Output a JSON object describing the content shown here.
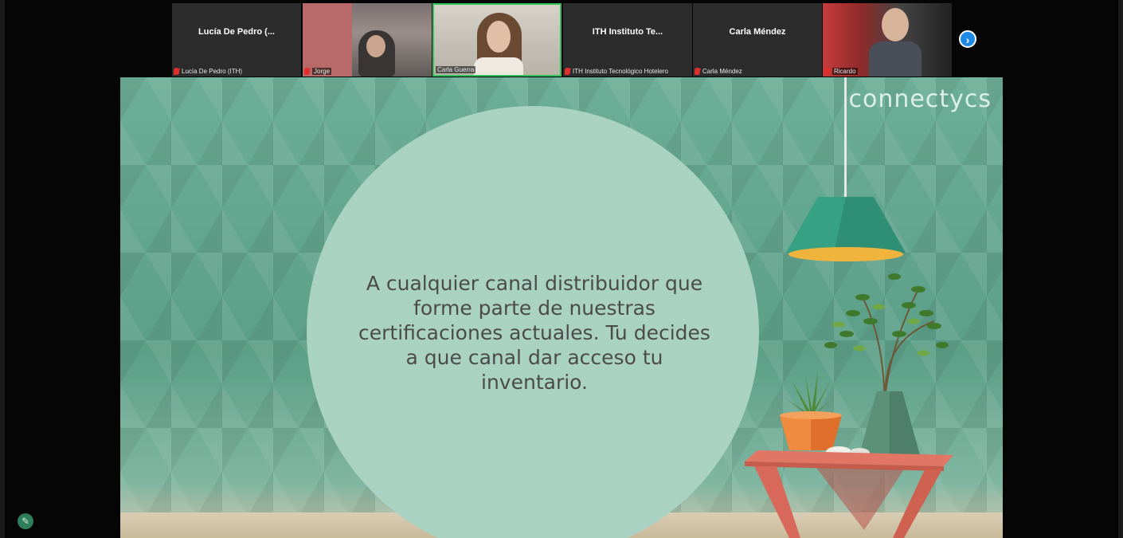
{
  "participants": [
    {
      "display_name": "Lucía De Pedro (...",
      "tag": "Lucía De Pedro (ITH)",
      "video": false
    },
    {
      "display_name": "",
      "tag": "Jorge",
      "video": true
    },
    {
      "display_name": "",
      "tag": "Carla Guerra",
      "video": true,
      "speaking": true
    },
    {
      "display_name": "ITH Instituto Te...",
      "tag": "ITH Instituto Tecnológico Hotelero",
      "video": false
    },
    {
      "display_name": "Carla Méndez",
      "tag": "Carla Méndez",
      "video": false
    },
    {
      "display_name": "",
      "tag": "Ricardo",
      "video": true
    }
  ],
  "gallery": {
    "next_page_glyph": "›"
  },
  "slide": {
    "logo": "connectycs",
    "text": "A cualquier canal distribuidor que forme parte de nuestras certificaciones actuales. Tu decides a que canal dar acceso tu inventario."
  },
  "toolbar": {
    "annotate_glyph": "✎"
  },
  "colors": {
    "speaker_border": "#2fc45a",
    "muted_mic": "#e0302d",
    "slide_background": "#5ea48d",
    "circle": "#a9d2c3",
    "accent_blue": "#1e88e5"
  },
  "icons": [
    "microphone-muted-icon",
    "chevron-right-icon",
    "annotate-pencil-icon"
  ]
}
